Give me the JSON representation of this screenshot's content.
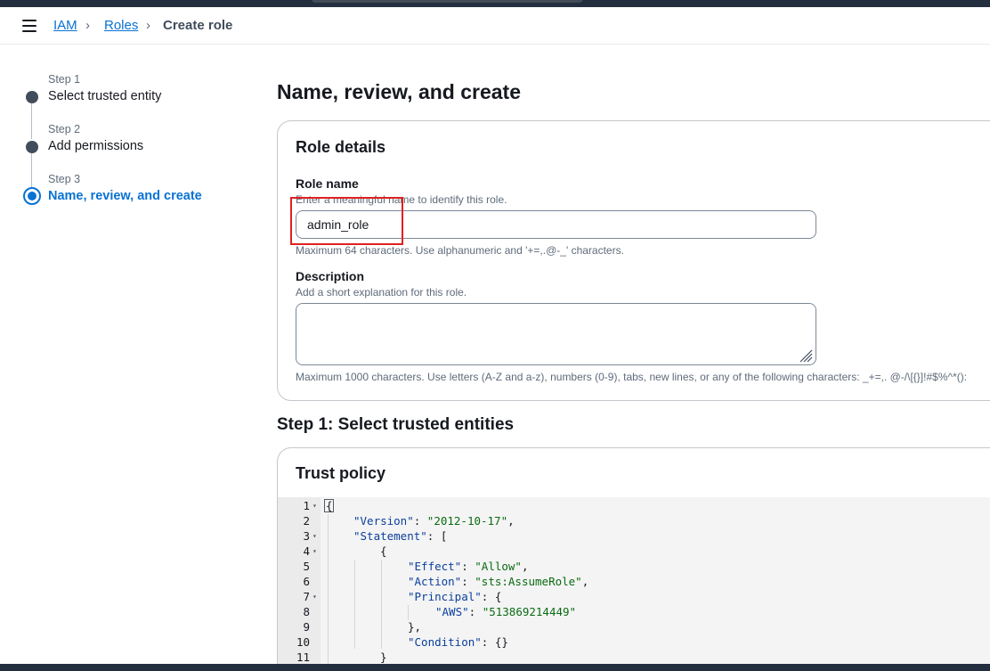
{
  "breadcrumb": {
    "items": [
      "IAM",
      "Roles",
      "Create role"
    ]
  },
  "wizard": {
    "steps": [
      {
        "num": "Step 1",
        "title": "Select trusted entity"
      },
      {
        "num": "Step 2",
        "title": "Add permissions"
      },
      {
        "num": "Step 3",
        "title": "Name, review, and create"
      }
    ],
    "active_step": 3
  },
  "page": {
    "title": "Name, review, and create"
  },
  "role_details": {
    "title": "Role details",
    "role_name_label": "Role name",
    "role_name_desc": "Enter a meaningful name to identify this role.",
    "role_name_value": "admin_role",
    "role_name_hint": "Maximum 64 characters. Use alphanumeric and '+=,.@-_' characters.",
    "description_label": "Description",
    "description_desc": "Add a short explanation for this role.",
    "description_value": "",
    "description_hint": "Maximum 1000 characters. Use letters (A-Z and a-z), numbers (0-9), tabs, new lines, or any of the following characters: _+=,. @-/\\[{}]!#$%^*():"
  },
  "step1": {
    "title": "Step 1: Select trusted entities"
  },
  "trust_policy": {
    "title": "Trust policy",
    "line_numbers": [
      "1",
      "2",
      "3",
      "4",
      "5",
      "6",
      "7",
      "8",
      "9",
      "10",
      "11"
    ],
    "lines": [
      "{",
      "\"Version\": \"2012-10-17\",",
      "\"Statement\": [",
      "{",
      "\"Effect\": \"Allow\",",
      "\"Action\": \"sts:AssumeRole\",",
      "\"Principal\": {",
      "\"AWS\": \"513869214449\"",
      "},",
      "\"Condition\": {}",
      "}"
    ]
  },
  "colors": {
    "accent": "#0972d3",
    "highlight": "#e02020",
    "header": "#232f3e"
  }
}
